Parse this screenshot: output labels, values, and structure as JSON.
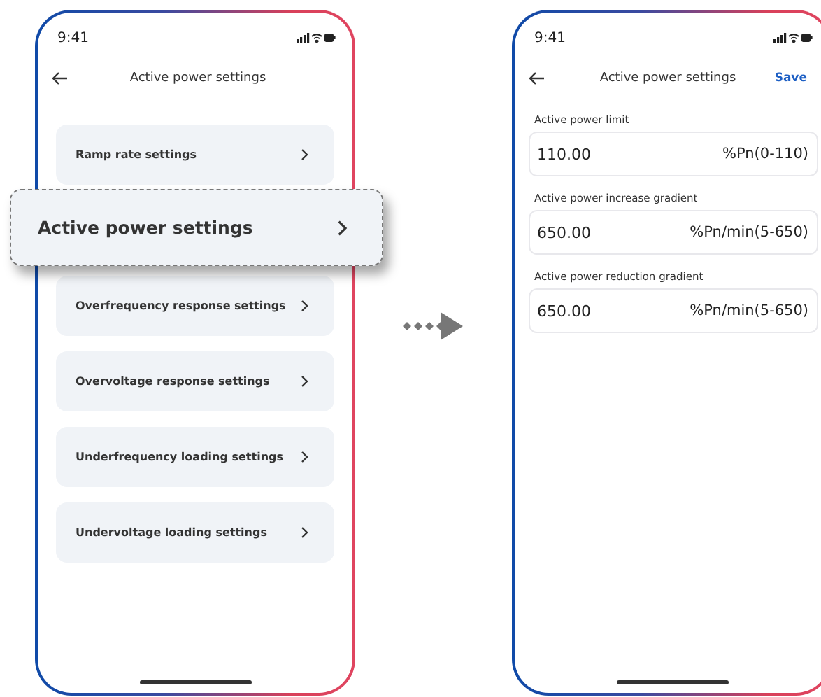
{
  "left_screen": {
    "status_time": "9:41",
    "title": "Active power settings",
    "items": [
      {
        "label": "Ramp rate settings",
        "highlighted": false
      },
      {
        "label": "Active power settings",
        "highlighted": true
      },
      {
        "label": "Overfrequency response settings",
        "highlighted": false
      },
      {
        "label": "Overvoltage response settings",
        "highlighted": false
      },
      {
        "label": "Underfrequency loading settings",
        "highlighted": false
      },
      {
        "label": "Undervoltage loading settings",
        "highlighted": false
      }
    ]
  },
  "right_screen": {
    "status_time": "9:41",
    "title": "Active power settings",
    "save_button": "Save",
    "fields": [
      {
        "label": "Active power limit",
        "value": "110.00",
        "unit": "%Pn(0-110)"
      },
      {
        "label": "Active power increase gradient",
        "value": "650.00",
        "unit": "%Pn/min(5-650)"
      },
      {
        "label": "Active power reduction gradient",
        "value": "650.00",
        "unit": "%Pn/min(5-650)"
      }
    ]
  }
}
